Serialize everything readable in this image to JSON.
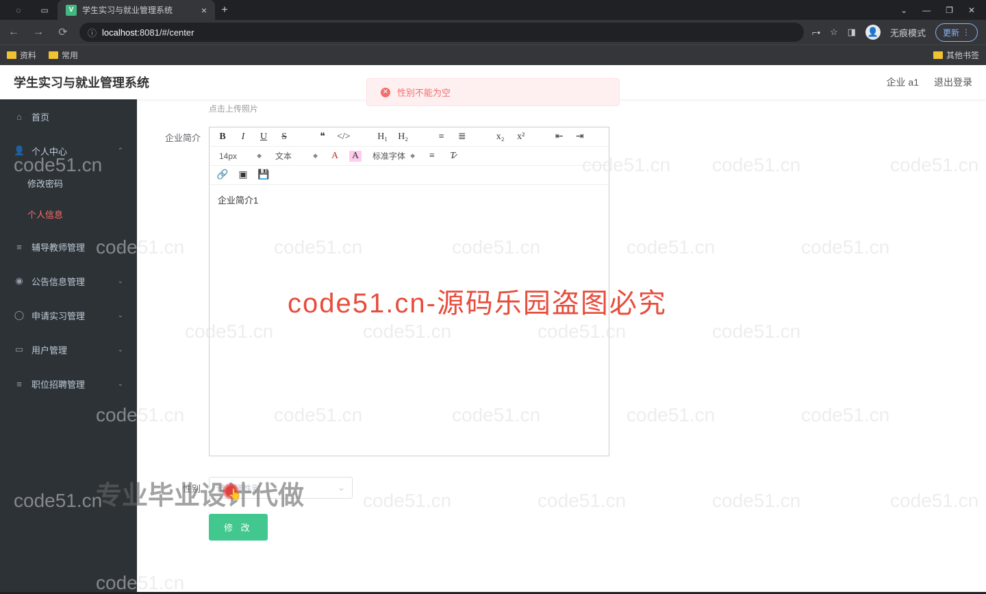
{
  "browser": {
    "tab_title": "学生实习与就业管理系统",
    "url_prefix": "localhost",
    "url_port_path": ":8081/#/center",
    "update": "更新",
    "incognito": "无痕模式"
  },
  "bookmarks": {
    "b1": "资料",
    "b2": "常用",
    "other": "其他书签"
  },
  "header": {
    "title": "学生实习与就业管理系统",
    "user": "企业 a1",
    "logout": "退出登录"
  },
  "toast": {
    "msg": "性别不能为空"
  },
  "sidebar": {
    "home": "首页",
    "personal": "个人中心",
    "changepw": "修改密码",
    "profile": "个人信息",
    "teacher": "辅导教师管理",
    "notice": "公告信息管理",
    "apply": "申请实习管理",
    "user": "用户管理",
    "job": "职位招聘管理"
  },
  "form": {
    "upload_hint": "点击上传照片",
    "intro_label": "企业简介",
    "intro_content": "企业简介1",
    "gender_label": "性别",
    "gender_placeholder": "请选择性别",
    "submit": "修 改"
  },
  "editor": {
    "size": "14px",
    "type": "文本",
    "font": "标准字体",
    "h1": "H₁",
    "h2": "H₂",
    "quote": "❝",
    "code": "</>"
  },
  "watermark": {
    "text": "code51.cn",
    "big": "code51.cn-源码乐园盗图必究",
    "bottom": "专业毕业设计代做"
  }
}
